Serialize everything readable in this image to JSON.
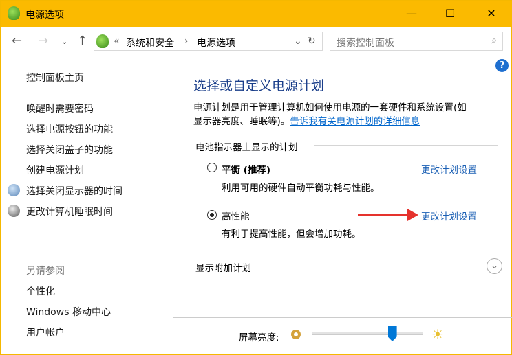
{
  "window": {
    "title": "电源选项"
  },
  "address": {
    "sep": "«",
    "crumbs": [
      "系统和安全",
      "电源选项"
    ]
  },
  "search": {
    "placeholder": "搜索控制面板"
  },
  "sidebar": {
    "home": "控制面板主页",
    "items": [
      "唤醒时需要密码",
      "选择电源按钮的功能",
      "选择关闭盖子的功能",
      "创建电源计划",
      "选择关闭显示器的时间",
      "更改计算机睡眠时间"
    ],
    "see_also": "另请参阅",
    "links": [
      "个性化",
      "Windows 移动中心",
      "用户帐户"
    ]
  },
  "main": {
    "heading": "选择或自定义电源计划",
    "desc1": "电源计划是用于管理计算机如何使用电源的一套硬件和系统设置(如",
    "desc2": "显示器亮度、睡眠等)。",
    "desc_link": "告诉我有关电源计划的详细信息",
    "group": "电池指示器上显示的计划",
    "plans": [
      {
        "name": "平衡 (推荐)",
        "desc": "利用可用的硬件自动平衡功耗与性能。",
        "link": "更改计划设置",
        "selected": false
      },
      {
        "name": "高性能",
        "desc": "有利于提高性能，但会增加功耗。",
        "link": "更改计划设置",
        "selected": true
      }
    ],
    "more": "显示附加计划"
  },
  "brightness": {
    "label": "屏幕亮度:",
    "value": 0.72
  },
  "colors": {
    "titlebar": "#fbba00",
    "accent": "#0078d7"
  }
}
